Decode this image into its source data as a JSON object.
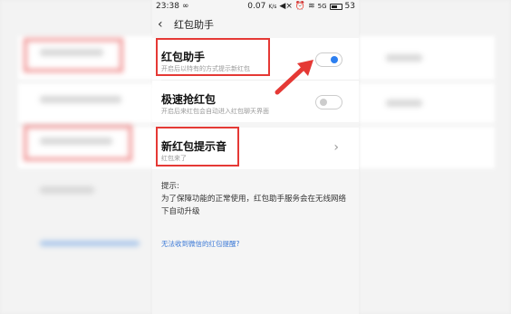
{
  "status_bar": {
    "time": "23:38",
    "loop_icon": "∞",
    "speed": "0.07",
    "speed_unit": "K/s",
    "signal": "5G",
    "battery": "53"
  },
  "header": {
    "back_icon": "chevron-left-icon",
    "title": "红包助手"
  },
  "settings": [
    {
      "title": "红包助手",
      "subtitle": "开启后以特有的方式提示新红包",
      "control": "toggle",
      "state": "on"
    },
    {
      "title": "极速抢红包",
      "subtitle": "开启后来红包会自动进入红包聊天界面",
      "control": "toggle",
      "state": "off"
    },
    {
      "title": "新红包提示音",
      "subtitle": "红包来了",
      "control": "chevron"
    }
  ],
  "hint": {
    "label": "提示:",
    "text": "为了保障功能的正常使用，红包助手服务会在无线网络下自动升级"
  },
  "link": "无法收到微信的红包提醒?",
  "colors": {
    "accent": "#2d7ff0",
    "annotation": "#e53935",
    "link": "#3a78d6"
  }
}
